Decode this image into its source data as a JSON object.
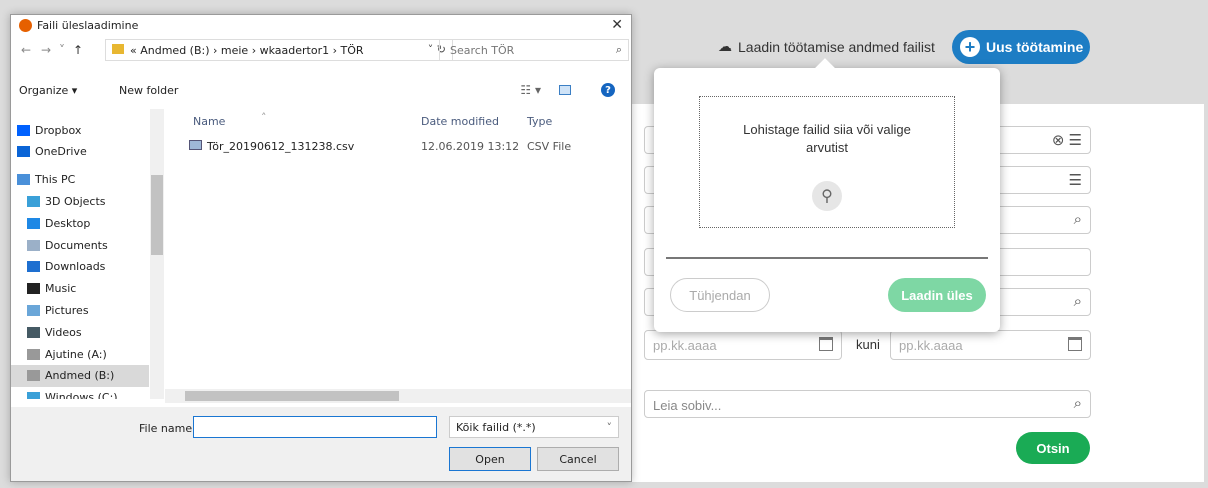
{
  "app": {
    "upload_link": "Laadin töötamise andmed failist",
    "new_button": "Uus töötamine",
    "date_placeholder_from": "pp.kk.aaaa",
    "date_separator": "kuni",
    "date_placeholder_to": "pp.kk.aaaa",
    "search_placeholder": "Leia sobiv...",
    "search_button": "Otsin"
  },
  "popover": {
    "drop_text": "Lohistage failid siia või valige arvutist",
    "clear_button": "Tühjendan",
    "upload_button": "Laadin üles"
  },
  "dialog": {
    "title": "Faili üleslaadimine",
    "breadcrumbs": "« Andmed (B:) › meie › wkaadertor1 › TÖR",
    "search_placeholder": "Search TÖR",
    "organize": "Organize ▾",
    "new_folder": "New folder",
    "nav_items": [
      {
        "label": "Dropbox",
        "icon": "dropbox-icon",
        "color": "#0061fe"
      },
      {
        "label": "OneDrive",
        "icon": "onedrive-icon",
        "color": "#0a64d6"
      },
      {
        "label": "This PC",
        "icon": "computer-icon",
        "color": "#4a90d9"
      },
      {
        "label": "3D Objects",
        "icon": "cube-icon",
        "color": "#3aa0d8"
      },
      {
        "label": "Desktop",
        "icon": "desktop-icon",
        "color": "#1e88e5"
      },
      {
        "label": "Documents",
        "icon": "documents-icon",
        "color": "#9bb0c8"
      },
      {
        "label": "Downloads",
        "icon": "download-icon",
        "color": "#1e6fd0"
      },
      {
        "label": "Music",
        "icon": "music-icon",
        "color": "#222222"
      },
      {
        "label": "Pictures",
        "icon": "pictures-icon",
        "color": "#6aa6d8"
      },
      {
        "label": "Videos",
        "icon": "videos-icon",
        "color": "#455a64"
      },
      {
        "label": "Ajutine (A:)",
        "icon": "drive-icon",
        "color": "#999999"
      },
      {
        "label": "Andmed (B:)",
        "icon": "drive-icon",
        "color": "#999999"
      },
      {
        "label": "Windows (C:)",
        "icon": "drive-icon",
        "color": "#3aa0d8"
      }
    ],
    "columns": {
      "name": "Name",
      "date": "Date modified",
      "type": "Type"
    },
    "file": {
      "name": "Tör_20190612_131238.csv",
      "date": "12.06.2019 13:12",
      "type": "CSV File"
    },
    "file_name_label": "File name:",
    "file_name_value": "",
    "file_type": "Kõik failid (*.*)",
    "open_button": "Open",
    "cancel_button": "Cancel"
  }
}
